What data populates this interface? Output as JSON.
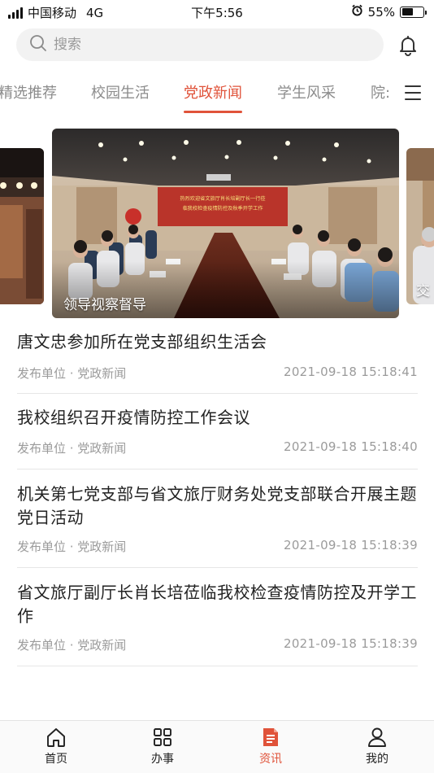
{
  "status_bar": {
    "carrier": "中国移动",
    "network": "4G",
    "time": "下午5:56",
    "battery_percent": "55%",
    "battery_level": 0.55
  },
  "search": {
    "placeholder": "搜索"
  },
  "tabs": [
    {
      "label": "精选推荐"
    },
    {
      "label": "校园生活"
    },
    {
      "label": "党政新闻"
    },
    {
      "label": "学生风采"
    },
    {
      "label": "院:"
    }
  ],
  "active_tab": "党政新闻",
  "carousel": {
    "main_caption": "领导视察督导",
    "right_caption": "交",
    "banner_text": "热烈欢迎省文旅厅肖长培副厅长一行莅临我校检查疫情防控及秋季开学工作"
  },
  "news": [
    {
      "title": "唐文忠参加所在党支部组织生活会",
      "source": "发布单位 · 党政新闻",
      "time": "2021-09-18 15:18:41"
    },
    {
      "title": "我校组织召开疫情防控工作会议",
      "source": "发布单位 · 党政新闻",
      "time": "2021-09-18 15:18:40"
    },
    {
      "title": "机关第七党支部与省文旅厅财务处党支部联合开展主题党日活动",
      "source": "发布单位 · 党政新闻",
      "time": "2021-09-18 15:18:39"
    },
    {
      "title": "省文旅厅副厅长肖长培莅临我校检查疫情防控及开学工作",
      "source": "发布单位 · 党政新闻",
      "time": "2021-09-18 15:18:39"
    }
  ],
  "bottom_nav": [
    {
      "label": "首页",
      "icon": "home-icon"
    },
    {
      "label": "办事",
      "icon": "grid-icon"
    },
    {
      "label": "资讯",
      "icon": "news-icon"
    },
    {
      "label": "我的",
      "icon": "user-icon"
    }
  ],
  "colors": {
    "accent": "#e0533a",
    "inactive": "#8c8c8c"
  }
}
